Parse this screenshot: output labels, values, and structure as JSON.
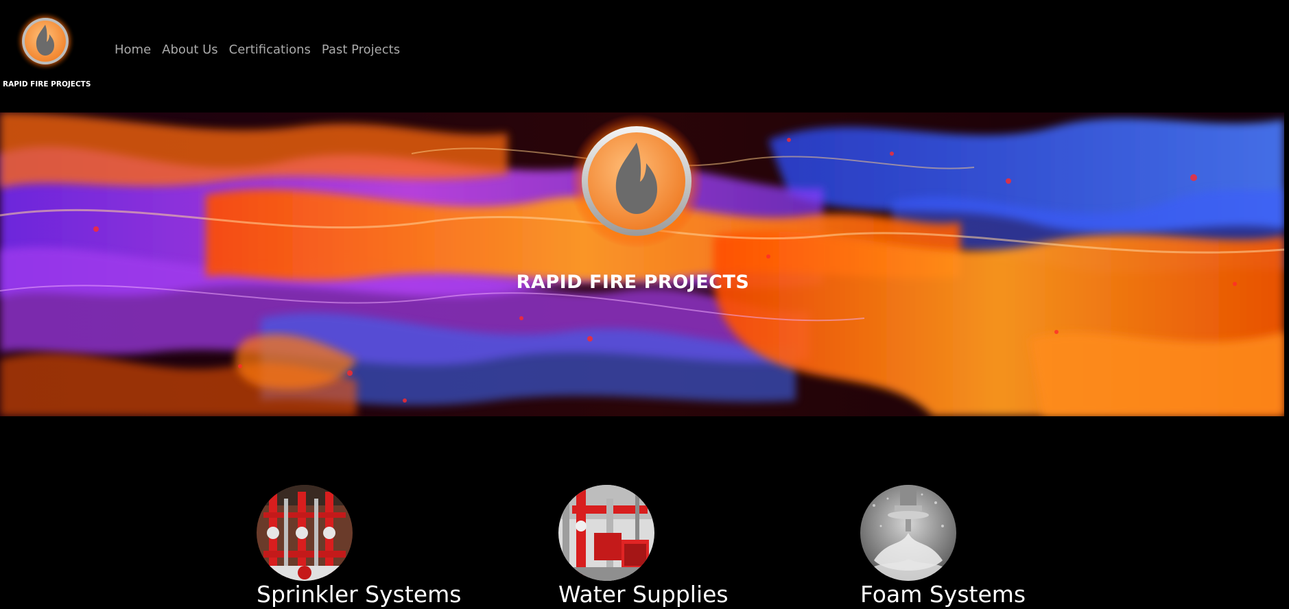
{
  "brand": {
    "name": "RAPID FIRE PROJECTS",
    "logo_icon": "flame-badge-icon",
    "accent_color": "#f7913a"
  },
  "nav": {
    "items": [
      {
        "label": "Home"
      },
      {
        "label": "About Us"
      },
      {
        "label": "Certifications"
      },
      {
        "label": "Past Projects"
      }
    ],
    "text_color": "#a9a9a9"
  },
  "hero": {
    "title": "RAPID FIRE PROJECTS",
    "emblem_icon": "flame-badge-icon",
    "colors": {
      "orange": "#ff7a10",
      "purple": "#9a3cf0",
      "blue": "#3d6df0",
      "dark": "#120008"
    }
  },
  "services": {
    "items": [
      {
        "label": "Sprinkler Systems",
        "image_icon": "sprinkler-valves-icon"
      },
      {
        "label": "Water Supplies",
        "image_icon": "pump-station-icon"
      },
      {
        "label": "Foam Systems",
        "image_icon": "sprinkler-head-icon"
      }
    ]
  }
}
